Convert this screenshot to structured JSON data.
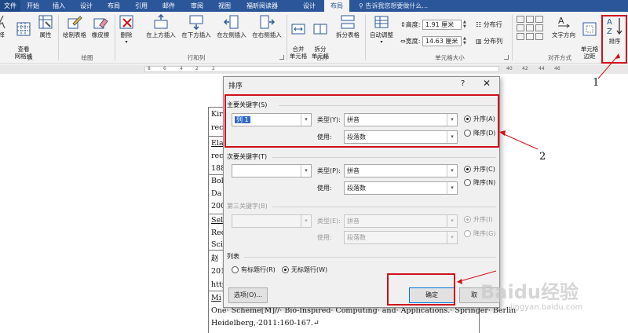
{
  "tabs": [
    "文件",
    "开始",
    "插入",
    "设计",
    "布局",
    "引用",
    "邮件",
    "审阅",
    "视图",
    "福昕阅读器",
    "设计",
    "布局"
  ],
  "tell_me": "告诉我您想要做什么...",
  "ribbon": {
    "select_label": "择",
    "gridlines_label": "查看\n网格线",
    "properties_label": "属性",
    "draw_table_label": "绘制表格",
    "eraser_label": "橡皮擦",
    "delete_label": "删除",
    "insert_above_label": "在上方插入",
    "insert_below_label": "在下方插入",
    "insert_left_label": "在左侧插入",
    "insert_right_label": "在右侧插入",
    "merge_cells_label": "合并\n单元格",
    "split_cells_label": "拆分\n单元格",
    "split_table_label": "拆分表格",
    "autofit_label": "自动调整",
    "height_label": "高度:",
    "height_value": "1.91 厘米",
    "width_label": "宽度:",
    "width_value": "14.63 厘米",
    "distribute_rows_label": "分布行",
    "distribute_cols_label": "分布列",
    "text_direction_label": "文字方向",
    "cell_margins_label": "单元格\n边距",
    "sort_label": "排序",
    "groups": {
      "table": "表",
      "draw": "绘图",
      "rows_cols": "行和列",
      "merge": "合并",
      "cell_size": "单元格大小",
      "alignment": "对齐方式"
    }
  },
  "ruler_numbers": [
    "8",
    "6",
    "4",
    "2",
    "2",
    "40",
    "42",
    "44",
    "46"
  ],
  "document": {
    "lines": [
      "Kir",
      "rec",
      "Ela",
      "rec",
      "188",
      "Bol",
      "Da",
      "200",
      "Sel",
      "Rec",
      "Sci",
      "赵",
      "201",
      "http",
      "Mi"
    ],
    "bottom_line1": "One· Scheme[M]//· Bio-Inspired· Computing· and· Applications.· Springer· Berlin·",
    "bottom_line2": "Heidelberg,·2011:160-167.↵"
  },
  "dialog": {
    "title": "排序",
    "help": "?",
    "close": "✕",
    "primary_key_label": "主要关键字(S)",
    "primary_key_value": "列 1",
    "type_label": "类型(Y):",
    "type_value": "拼音",
    "using_label": "使用:",
    "using_value": "段落数",
    "asc_label": "升序(A)",
    "desc_label": "降序(D)",
    "secondary_key_label": "次要关键字(T)",
    "secondary_type_label": "类型(P):",
    "secondary_type_value": "拼音",
    "secondary_using_label": "使用:",
    "secondary_using_value": "段落数",
    "secondary_asc_label": "升序(C)",
    "secondary_desc_label": "降序(N)",
    "tertiary_key_label": "第三关键字(B)",
    "tertiary_type_label": "类型(E):",
    "tertiary_type_value": "拼音",
    "tertiary_using_label": "使用:",
    "tertiary_using_value": "段落数",
    "tertiary_asc_label": "升序(I)",
    "tertiary_desc_label": "降序(G)",
    "list_label": "列表",
    "has_header_label": "有标题行(R)",
    "no_header_label": "无标题行(W)",
    "options_button": "选项(O)...",
    "ok_button": "确定",
    "cancel_button": "取"
  },
  "annotations": {
    "one": "1",
    "two": "2"
  },
  "watermark": {
    "brand": "Baidu经验",
    "url": "jingyan.baidu.com"
  }
}
